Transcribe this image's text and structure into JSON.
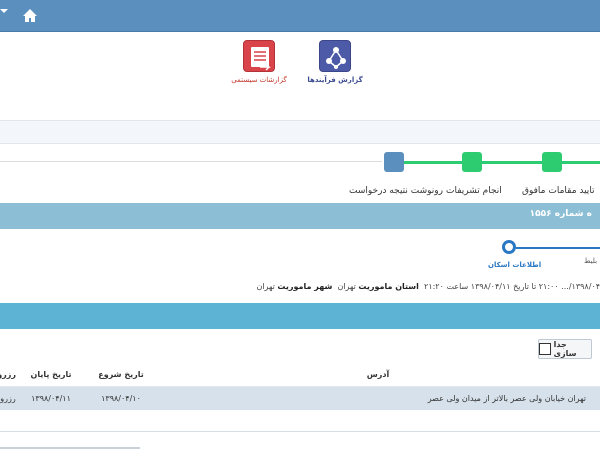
{
  "apps": {
    "process_report_label": "گزارش فرآیندها",
    "system_reports_label": "گزارشات سیستمی"
  },
  "workflow_steps": [
    {
      "label": "تایید مقامات مافوق",
      "state": "done"
    },
    {
      "label": "انجام تشریفات",
      "state": "done"
    },
    {
      "label": "رونوشت نتیجه درخواست",
      "state": "pending"
    }
  ],
  "section_title": "ه شماره ۱۵۵۶",
  "substeps": {
    "active_label": "اطلاعات اسکان",
    "prev_label": "بلیط"
  },
  "details": {
    "dates_text": "۱۳۹۸/۰۴/... ۲۱:۰۰ تا تاریخ ۱۳۹۸/۰۴/۱۱ ساعت ۲۱:۲۰",
    "province_label": "استان ماموریت",
    "province_value": "تهران",
    "city_label": "شهر ماموریت",
    "city_value": "تهران"
  },
  "toolbar": {
    "separate_label": "جدا سازی"
  },
  "table": {
    "columns": [
      "آدرس",
      "تاریخ شروع",
      "تاریخ پایان",
      "رزرو"
    ],
    "rows": [
      {
        "address": "تهران خیابان ولی عصر بالاتر از میدان ولی عصر",
        "start": "۱۳۹۸/۰۴/۱۰",
        "end": "۱۳۹۸/۰۴/۱۱",
        "reserve": "رزرو"
      }
    ]
  },
  "colors": {
    "topbar": "#5a8fbe",
    "step_done": "#2ecc71",
    "step_pending": "#5b8fbd",
    "section_bar": "#8cbfd6",
    "teal_bar": "#5cb3d4",
    "row_bg": "#d7e1eb"
  }
}
